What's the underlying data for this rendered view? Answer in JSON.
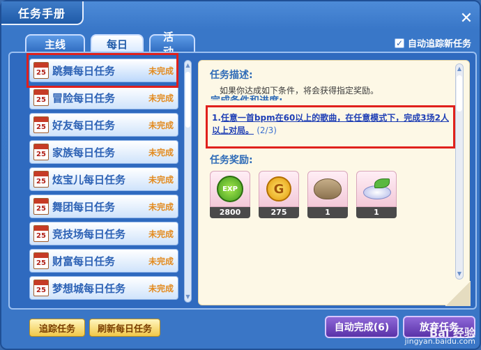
{
  "window": {
    "title": "任务手册"
  },
  "tabs": [
    {
      "label": "主线",
      "active": false
    },
    {
      "label": "每日",
      "active": true
    },
    {
      "label": "活动",
      "active": false
    }
  ],
  "auto_track": {
    "label": "自动追踪新任务",
    "checked": true,
    "check_glyph": "✓"
  },
  "close_glyph": "✕",
  "calendar_number": "25",
  "tasks": [
    {
      "label": "跳舞每日任务",
      "status": "未完成",
      "selected": true
    },
    {
      "label": "冒险每日任务",
      "status": "未完成",
      "selected": false
    },
    {
      "label": "好友每日任务",
      "status": "未完成",
      "selected": false
    },
    {
      "label": "家族每日任务",
      "status": "未完成",
      "selected": false
    },
    {
      "label": "炫宝儿每日任务",
      "status": "未完成",
      "selected": false
    },
    {
      "label": "舞团每日任务",
      "status": "未完成",
      "selected": false
    },
    {
      "label": "竞技场每日任务",
      "status": "未完成",
      "selected": false
    },
    {
      "label": "财富每日任务",
      "status": "未完成",
      "selected": false
    },
    {
      "label": "梦想城每日任务",
      "status": "未完成",
      "selected": false
    }
  ],
  "detail": {
    "desc_title": "任务描述:",
    "desc_text": "如果你达成如下条件，将会获得指定奖励。",
    "cond_title": "完成条件和进度:",
    "condition": {
      "index": "1.",
      "text": "任意一首bpm在60以上的歌曲，在任意模式下，完成3场2人以上对局。",
      "progress": "(2/3)"
    },
    "reward_title": "任务奖励:",
    "rewards": [
      {
        "icon": "exp-icon",
        "icon_text": "EXP",
        "count": "2800"
      },
      {
        "icon": "gold-coin-icon",
        "icon_text": "G",
        "count": "275"
      },
      {
        "icon": "sack-icon",
        "icon_text": "",
        "count": "1"
      },
      {
        "icon": "dish-icon",
        "icon_text": "",
        "count": "1"
      }
    ]
  },
  "buttons": {
    "track": "追踪任务",
    "refresh": "刷新每日任务",
    "auto_complete": "自动完成(6)",
    "abandon": "放弃任务"
  },
  "scroll_arrows": {
    "up": "▲",
    "down": "▼"
  },
  "watermark": {
    "line1": "Bai 经验",
    "line2": "jingyan.baidu.com"
  },
  "colors": {
    "accent_blue": "#2e6bb7",
    "status_orange": "#e38a1d",
    "highlight_red": "#e0201c"
  }
}
